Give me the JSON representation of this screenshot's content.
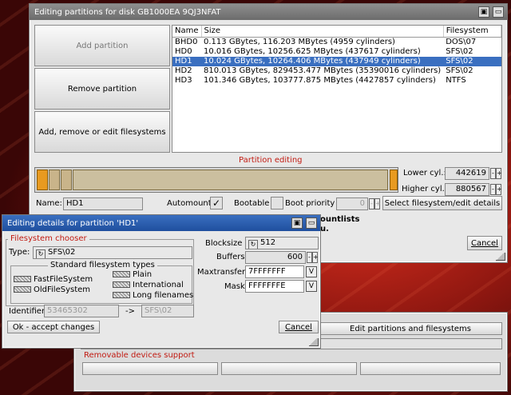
{
  "main_window": {
    "title": "Editing partitions for disk GB1000EA 9QJ3NFAT",
    "add_partition": "Add partition",
    "remove_partition": "Remove partition",
    "edit_filesystems": "Add, remove or edit filesystems",
    "table": {
      "headers": [
        "Name",
        "Size",
        "Filesystem"
      ],
      "rows": [
        {
          "name": "BHD0",
          "size": "0.113 GBytes, 116.203 MBytes (4959 cylinders)",
          "fs": "DOS\\07"
        },
        {
          "name": "HD0",
          "size": "10.016 GBytes, 10256.625 MBytes (437617 cylinders)",
          "fs": "SFS\\02"
        },
        {
          "name": "HD1",
          "size": "10.024 GBytes, 10264.406 MBytes (437949 cylinders)",
          "fs": "SFS\\02"
        },
        {
          "name": "HD2",
          "size": "810.013 GBytes, 829453.477 MBytes (35390016 cylinders)",
          "fs": "SFS\\02"
        },
        {
          "name": "HD3",
          "size": "101.346 GBytes, 103777.875 MBytes (4427857 cylinders)",
          "fs": "NTFS"
        }
      ],
      "selected_index": 2
    },
    "partition_editing": "Partition editing",
    "lower_cyl_label": "Lower cyl.:",
    "lower_cyl_value": "442619",
    "higher_cyl_label": "Higher cyl.:",
    "higher_cyl_value": "880567",
    "name_label": "Name:",
    "name_value": "HD1",
    "automount_label": "Automount",
    "automount_checked": true,
    "bootable_label": "Bootable",
    "bootable_checked": false,
    "boot_priority_label": "Boot priority",
    "boot_priority_value": "0",
    "select_fs_button": "Select filesystem/edit details",
    "behind_text_1": "ountlists",
    "behind_text_2": "u.",
    "cancel": "Cancel"
  },
  "details_window": {
    "title": "Editing details for partition 'HD1'",
    "fs_chooser": "Filesystem chooser",
    "type_label": "Type:",
    "type_value": "SFS\\02",
    "std_types": "Standard filesystem types",
    "fs_types_left": [
      "FastFileSystem",
      "OldFileSystem"
    ],
    "fs_types_right": [
      "Plain",
      "International",
      "Long filenames"
    ],
    "identifier_label": "Identifier",
    "identifier_value": "53465302",
    "arrow": "->",
    "identifier_target": "SFS\\02",
    "blocksize_label": "Blocksize",
    "blocksize_value": "512",
    "buffers_label": "Buffers",
    "buffers_value": "600",
    "maxtransfer_label": "Maxtransfer",
    "maxtransfer_value": "7FFFFFFF",
    "mask_label": "Mask",
    "mask_value": "FFFFFFFE",
    "ok_button": "Ok - accept changes",
    "cancel_button": "Cancel"
  },
  "back_window": {
    "edit_partitions": "Edit partitions and filesystems",
    "removable": "Removable devices support"
  }
}
